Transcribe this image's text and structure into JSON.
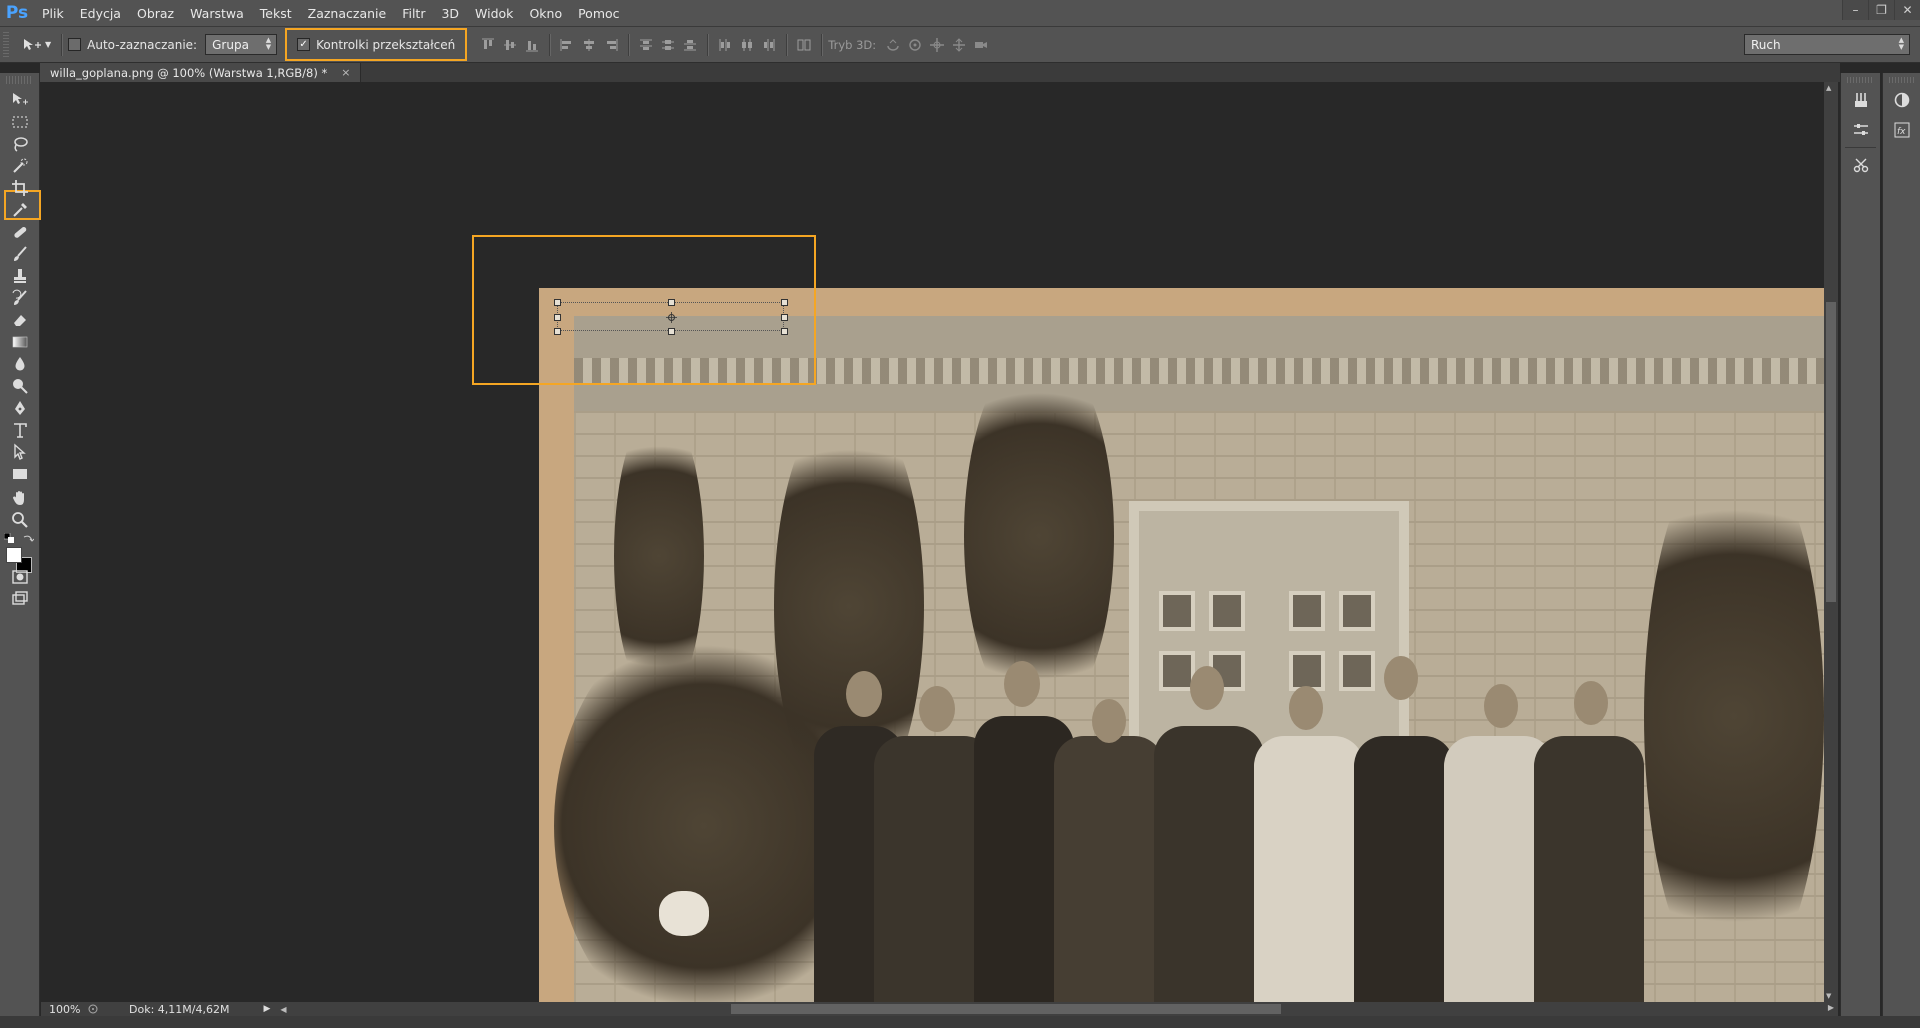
{
  "app": {
    "logo": "Ps"
  },
  "menu": [
    "Plik",
    "Edycja",
    "Obraz",
    "Warstwa",
    "Tekst",
    "Zaznaczanie",
    "Filtr",
    "3D",
    "Widok",
    "Okno",
    "Pomoc"
  ],
  "window_controls": {
    "minimize": "–",
    "restore": "❐",
    "close": "✕"
  },
  "options": {
    "auto_select_label": "Auto-zaznaczanie:",
    "auto_select_checked": false,
    "group_value": "Grupa",
    "transform_controls_label": "Kontrolki przekształceń",
    "transform_controls_checked": true,
    "mode3d_label": "Tryb 3D:",
    "workspace_value": "Ruch"
  },
  "document": {
    "tab_title": "willa_goplana.png @ 100% (Warstwa 1,RGB/8) *",
    "tab_close": "×"
  },
  "status": {
    "zoom": "100%",
    "doc_size": "Dok: 4,11M/4,62M"
  },
  "colors": {
    "highlight": "#f5a623",
    "chrome": "#535353",
    "canvas_bg": "#282828",
    "foreground_swatch": "#ffffff",
    "background_swatch": "#000000"
  },
  "icons": {
    "tools": [
      "move-icon",
      "rect-marquee-icon",
      "lasso-icon",
      "quick-select-icon",
      "crop-icon",
      "eyedropper-icon",
      "healing-brush-icon",
      "brush-icon",
      "clone-stamp-icon",
      "history-brush-icon",
      "eraser-icon",
      "gradient-icon",
      "blur-icon",
      "dodge-icon",
      "pen-icon",
      "type-icon",
      "path-select-icon",
      "rectangle-shape-icon",
      "hand-icon",
      "zoom-icon"
    ]
  }
}
